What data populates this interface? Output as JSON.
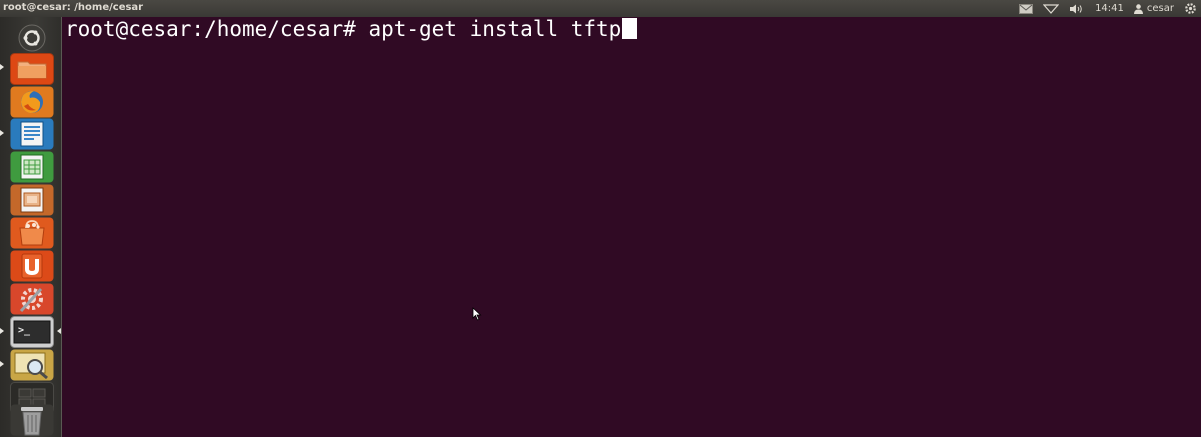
{
  "window": {
    "title": "root@cesar: /home/cesar"
  },
  "panel": {
    "indicators": [
      {
        "icon": "mail-icon"
      },
      {
        "icon": "network-icon"
      },
      {
        "icon": "volume-icon"
      }
    ],
    "clock": "14:41",
    "user": "cesar",
    "session_icon": "gear-icon"
  },
  "launcher": {
    "items": [
      {
        "name": "dash-home",
        "icon": "ubuntu-logo-icon"
      },
      {
        "name": "files",
        "icon": "folder-icon",
        "running": true
      },
      {
        "name": "firefox",
        "icon": "firefox-icon"
      },
      {
        "name": "libreoffice-writer",
        "icon": "writer-icon",
        "running": true
      },
      {
        "name": "libreoffice-calc",
        "icon": "calc-icon"
      },
      {
        "name": "libreoffice-impress",
        "icon": "impress-icon"
      },
      {
        "name": "software-center",
        "icon": "shopping-bag-icon"
      },
      {
        "name": "ubuntu-one",
        "icon": "ubuntu-one-icon"
      },
      {
        "name": "system-settings",
        "icon": "settings-icon"
      },
      {
        "name": "terminal",
        "icon": "terminal-icon",
        "running": true,
        "focused": true
      },
      {
        "name": "system-monitor",
        "icon": "magnifier-icon",
        "running": true
      },
      {
        "name": "workspace-switcher",
        "icon": "workspaces-icon"
      },
      {
        "name": "trash",
        "icon": "trash-icon"
      }
    ],
    "terminal_icon_text": ">_"
  },
  "terminal": {
    "prompt": "root@cesar:/home/cesar#",
    "command": "apt-get install tftp",
    "background": "#300a24",
    "foreground": "#ffffff"
  }
}
